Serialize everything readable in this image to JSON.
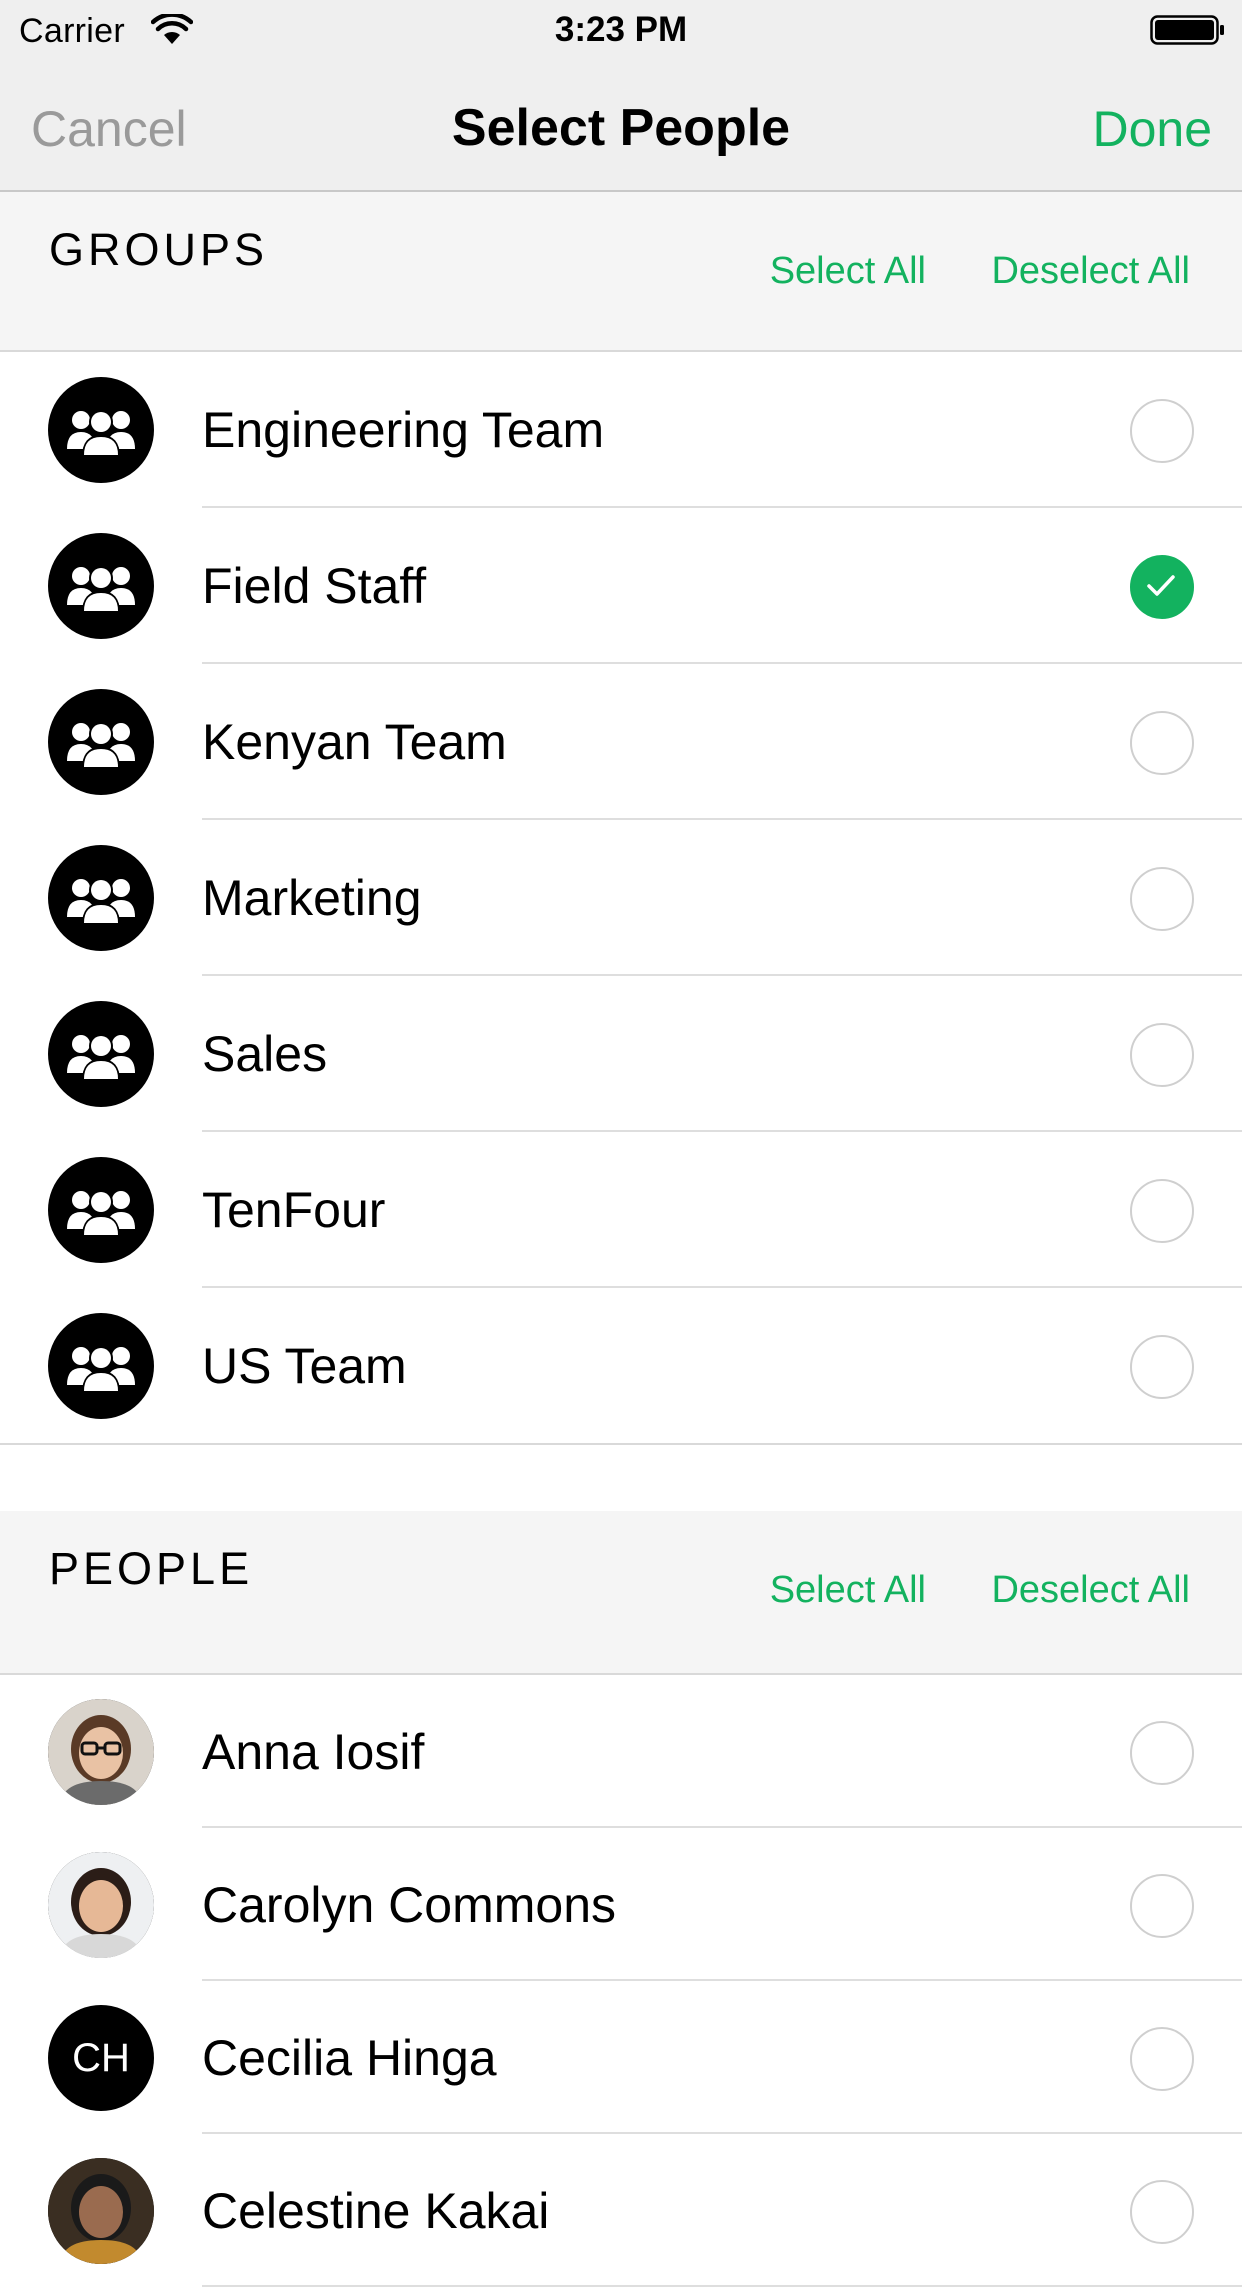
{
  "status_bar": {
    "carrier": "Carrier",
    "time": "3:23 PM",
    "wifi_icon": "wifi-icon",
    "battery_icon": "battery-icon"
  },
  "nav": {
    "cancel_label": "Cancel",
    "title": "Select People",
    "done_label": "Done"
  },
  "colors": {
    "accent": "#13b25f",
    "muted": "#9a9a9a",
    "header_bg": "#efefef",
    "section_bg": "#f5f5f5"
  },
  "groups": {
    "title": "GROUPS",
    "select_all_label": "Select All",
    "deselect_all_label": "Deselect All",
    "items": [
      {
        "name": "Engineering Team",
        "icon": "group-icon",
        "selected": false
      },
      {
        "name": "Field Staff",
        "icon": "group-icon",
        "selected": true
      },
      {
        "name": "Kenyan Team",
        "icon": "group-icon",
        "selected": false
      },
      {
        "name": "Marketing",
        "icon": "group-icon",
        "selected": false
      },
      {
        "name": "Sales",
        "icon": "group-icon",
        "selected": false
      },
      {
        "name": "TenFour",
        "icon": "group-icon",
        "selected": false
      },
      {
        "name": "US Team",
        "icon": "group-icon",
        "selected": false
      }
    ]
  },
  "people": {
    "title": "PEOPLE",
    "select_all_label": "Select All",
    "deselect_all_label": "Deselect All",
    "items": [
      {
        "name": "Anna Iosif",
        "avatar": "photo",
        "selected": false
      },
      {
        "name": "Carolyn Commons",
        "avatar": "photo",
        "selected": false
      },
      {
        "name": "Cecilia Hinga",
        "avatar": "initials",
        "initials": "CH",
        "selected": false
      },
      {
        "name": "Celestine Kakai",
        "avatar": "photo",
        "selected": false
      }
    ]
  }
}
